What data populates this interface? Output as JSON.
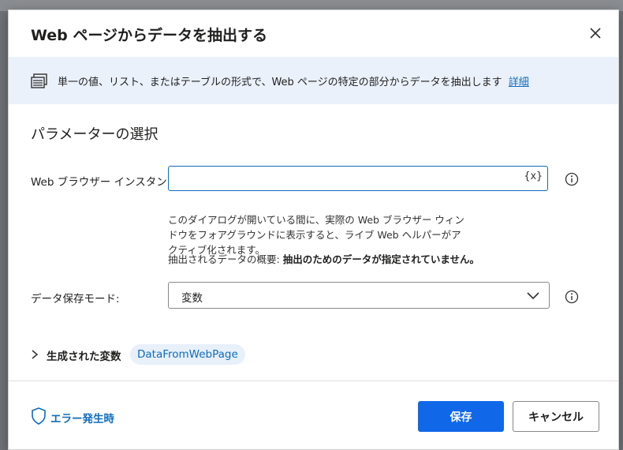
{
  "dialog": {
    "title": "Web ページからデータを抽出する",
    "close_icon": "close-icon"
  },
  "banner": {
    "icon": "table-icon",
    "text": "単一の値、リスト、またはテーブルの形式で、Web ページの特定の部分からデータを抽出します",
    "link_label": "詳細"
  },
  "section": {
    "title": "パラメーターの選択"
  },
  "browser_instance": {
    "label": "Web ブラウザー インスタンス:",
    "value": "",
    "variable_button": "{x}",
    "info_icon": "info-icon"
  },
  "help": {
    "text": "このダイアログが開いている間に、実際の Web ブラウザー ウィンドウをフォアグラウンドに表示すると、ライブ Web ヘルパーがアクティブ化されます。",
    "summary_label": "抽出されるデータの概要:",
    "summary_value": "抽出のためのデータが指定されていません。"
  },
  "storage_mode": {
    "label": "データ保存モード:",
    "selected": "変数",
    "info_icon": "info-icon"
  },
  "generated_variables": {
    "label": "生成された変数",
    "variable": "DataFromWebPage"
  },
  "footer": {
    "error_label": "エラー発生時",
    "save_label": "保存",
    "cancel_label": "キャンセル"
  },
  "colors": {
    "accent": "#0f6cbd",
    "primary_button": "#1068e8",
    "banner_bg": "#eaf1fb"
  }
}
